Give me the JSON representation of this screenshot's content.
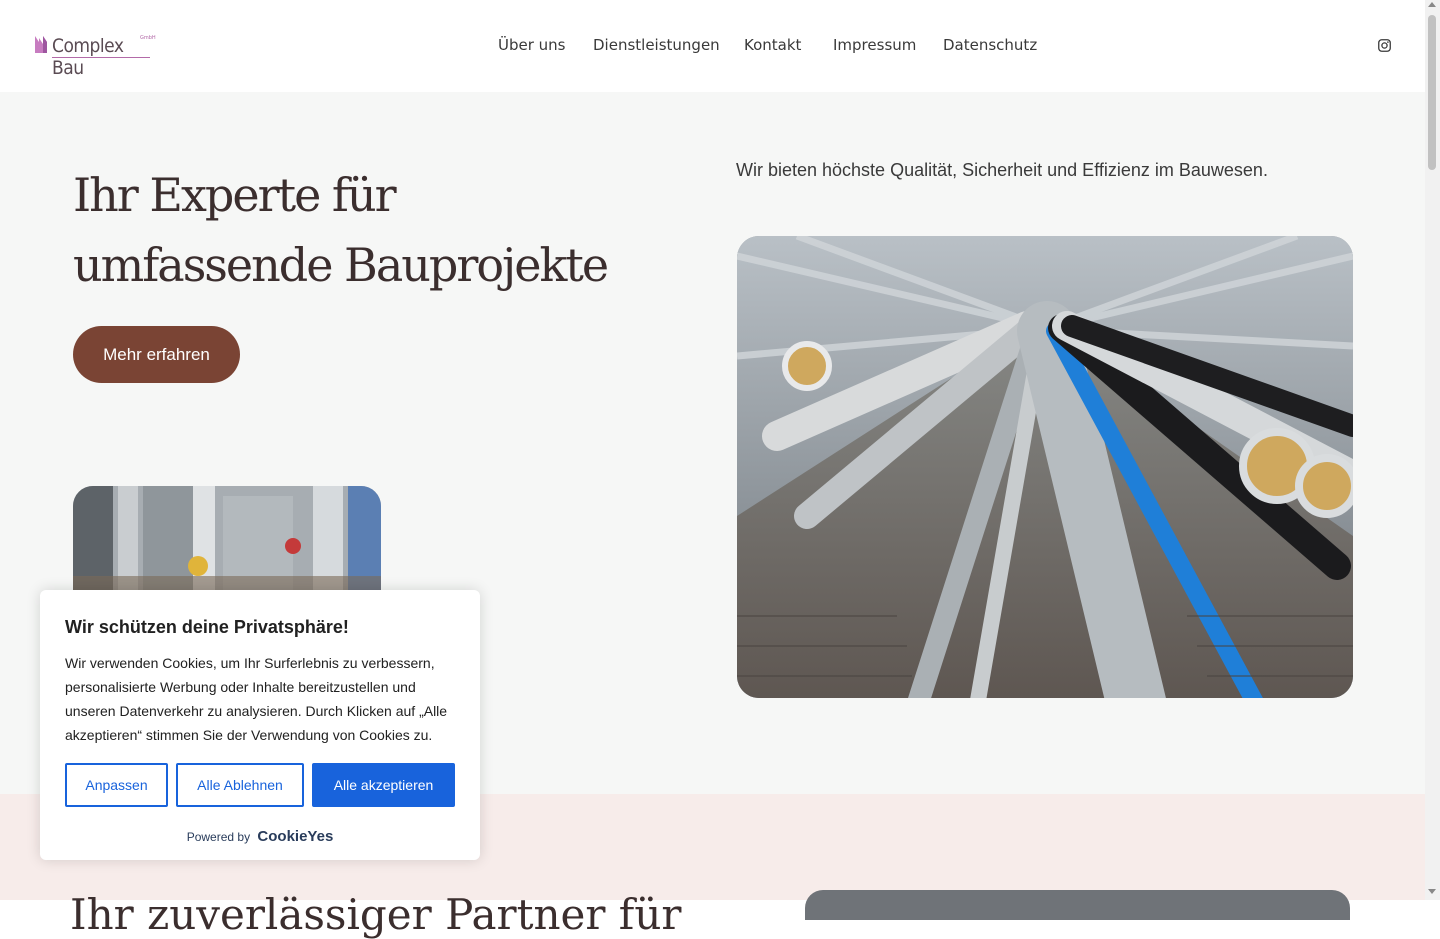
{
  "header": {
    "logo_text": "Complex Bau",
    "logo_small": "GmbH",
    "nav": [
      "Über uns",
      "Dienstleistungen",
      "Kontakt",
      "Impressum",
      "Datenschutz"
    ],
    "social_icon": "instagram-icon"
  },
  "hero": {
    "title_line1": "Ihr Experte für",
    "title_line2": "umfassende Bauprojekte",
    "cta_label": "Mehr erfahren",
    "subtitle": "Wir bieten höchste Qualität, Sicherheit und Effizienz im Bauwesen."
  },
  "section2": {
    "title": "Ihr zuverlässiger Partner für"
  },
  "cookie": {
    "title": "Wir schützen deine Privatsphäre!",
    "text": "Wir verwenden Cookies, um Ihr Surferlebnis zu verbessern, personalisierte Werbung oder Inhalte bereitzustellen und unseren Datenverkehr zu analysieren. Durch Klicken auf „Alle akzeptieren“ stimmen Sie der Verwendung von Cookies zu.",
    "customize_label": "Anpassen",
    "reject_label": "Alle Ablehnen",
    "accept_label": "Alle akzeptieren",
    "powered_by": "Powered by",
    "brand": "CookieYes"
  },
  "colors": {
    "brand": "#b36aa8",
    "cta": "#7a4434",
    "cookie_accent": "#1863dc",
    "hero_bg": "#f6f7f6",
    "section2_bg": "#f7ecea"
  }
}
